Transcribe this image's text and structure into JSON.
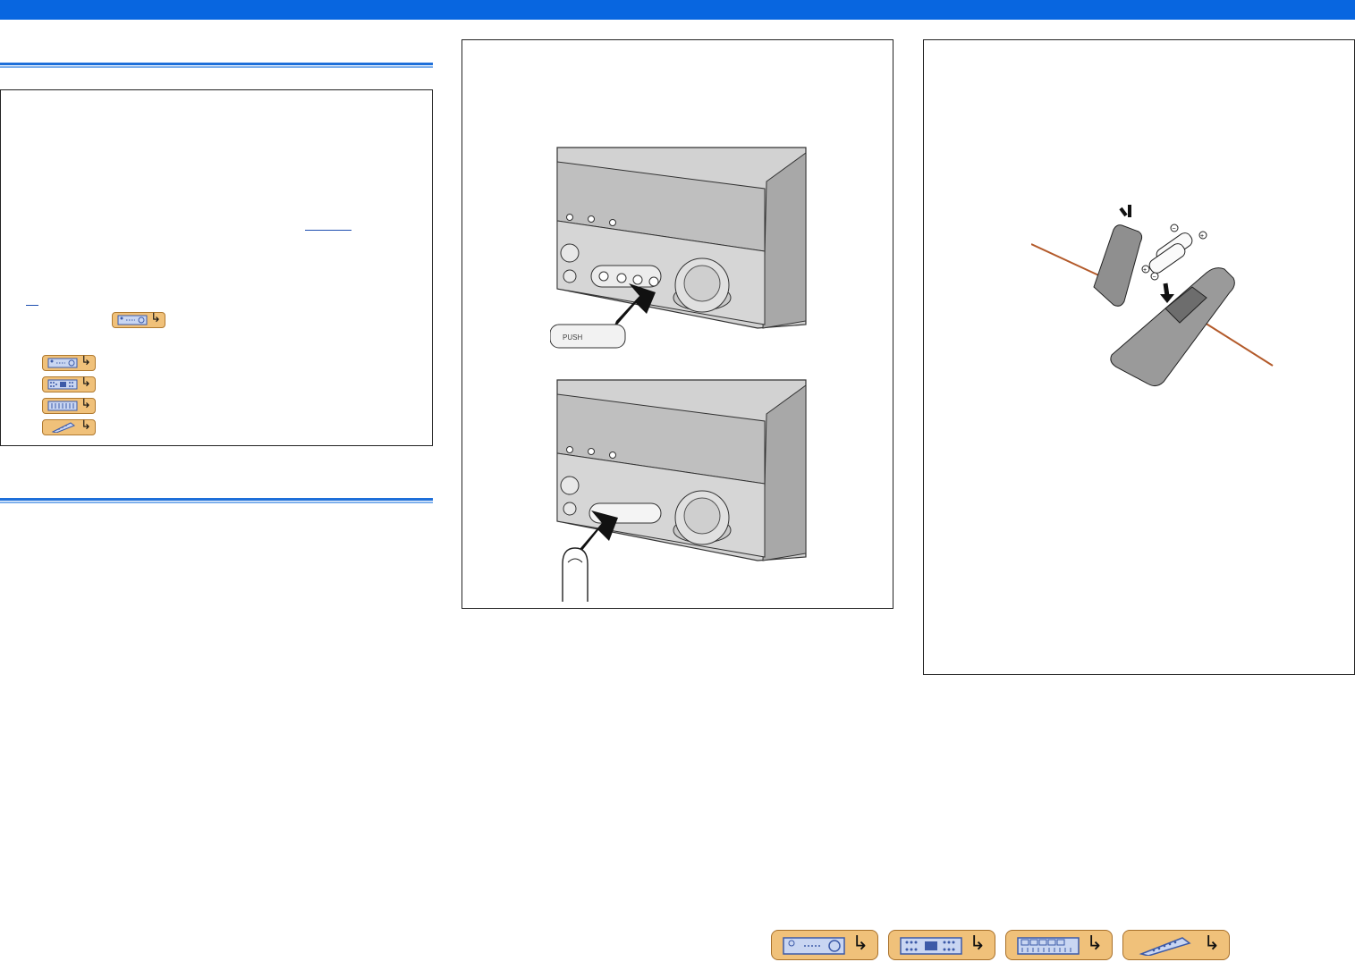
{
  "colors": {
    "header_bar": "#0866e0",
    "rule": "#1e6fd9",
    "tag_fill": "#f0c17a"
  },
  "icons": {
    "receiver": "receiver-icon",
    "front_panel": "front-panel-icon",
    "display": "display-icon",
    "remote": "remote-icon",
    "arrow": "return-arrow-icon"
  },
  "nav": {
    "buttons": [
      {
        "name": "receiver-nav-button",
        "icon": "receiver-icon"
      },
      {
        "name": "front-panel-nav-button",
        "icon": "front-panel-icon"
      },
      {
        "name": "display-nav-button",
        "icon": "display-icon"
      },
      {
        "name": "remote-nav-button",
        "icon": "remote-icon"
      }
    ]
  },
  "figures": {
    "front_panel_upper": {
      "button_text": "PUSH"
    },
    "front_panel_lower": {},
    "remote_batteries": {}
  }
}
